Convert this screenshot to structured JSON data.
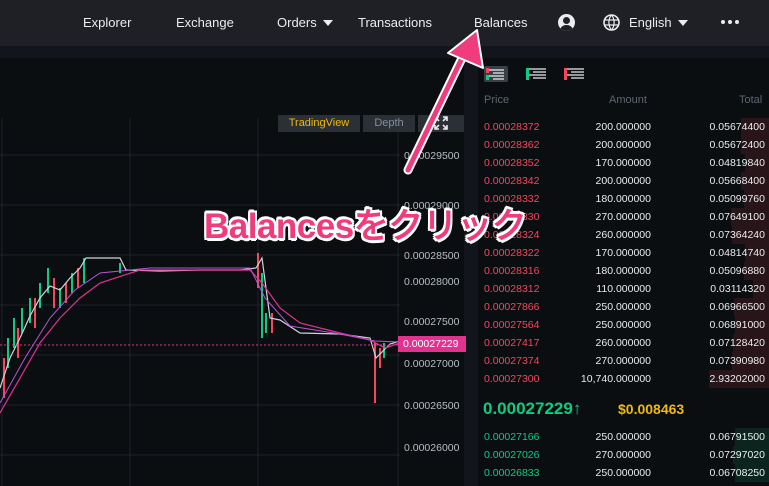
{
  "nav": {
    "items": [
      "Explorer",
      "Exchange",
      "Orders",
      "Transactions",
      "Balances"
    ],
    "language": "English"
  },
  "chart": {
    "tabs": [
      "TradingView",
      "Depth"
    ],
    "y_ticks": [
      "0.00029500",
      "0.00029000",
      "0.00028500",
      "0.00028000",
      "0.00027500",
      "0.00027000",
      "0.00026500",
      "0.00026000"
    ],
    "current_price_tag": "0.00027229"
  },
  "orderbook": {
    "headers": {
      "price": "Price",
      "amount": "Amount",
      "total": "Total"
    },
    "asks": [
      {
        "price": "0.00028372",
        "amount": "200.000000",
        "total": "0.05674400"
      },
      {
        "price": "0.00028362",
        "amount": "200.000000",
        "total": "0.05672400"
      },
      {
        "price": "0.00028352",
        "amount": "170.000000",
        "total": "0.04819840"
      },
      {
        "price": "0.00028342",
        "amount": "200.000000",
        "total": "0.05668400"
      },
      {
        "price": "0.00028332",
        "amount": "180.000000",
        "total": "0.05099760"
      },
      {
        "price": "0.00028330",
        "amount": "270.000000",
        "total": "0.07649100"
      },
      {
        "price": "0.00028324",
        "amount": "260.000000",
        "total": "0.07364240"
      },
      {
        "price": "0.00028322",
        "amount": "170.000000",
        "total": "0.04814740"
      },
      {
        "price": "0.00028316",
        "amount": "180.000000",
        "total": "0.05096880"
      },
      {
        "price": "0.00028312",
        "amount": "110.000000",
        "total": "0.03114320"
      },
      {
        "price": "0.00027866",
        "amount": "250.000000",
        "total": "0.06966500"
      },
      {
        "price": "0.00027564",
        "amount": "250.000000",
        "total": "0.06891000"
      },
      {
        "price": "0.00027417",
        "amount": "260.000000",
        "total": "0.07128420"
      },
      {
        "price": "0.00027374",
        "amount": "270.000000",
        "total": "0.07390980"
      },
      {
        "price": "0.00027300",
        "amount": "10,740.000000",
        "total": "2.93202000"
      }
    ],
    "last_price": "0.00027229↑",
    "last_price_usd": "$0.008463",
    "bids": [
      {
        "price": "0.00027166",
        "amount": "250.000000",
        "total": "0.06791500"
      },
      {
        "price": "0.00027026",
        "amount": "270.000000",
        "total": "0.07297020"
      },
      {
        "price": "0.00026833",
        "amount": "250.000000",
        "total": "0.06708250"
      }
    ]
  },
  "annotation": {
    "text": "Balancesをクリック"
  },
  "colors": {
    "ask": "#f6465d",
    "bid": "#0ecb81",
    "accent": "#f0b90b",
    "annotation": "#ef3c7c"
  }
}
